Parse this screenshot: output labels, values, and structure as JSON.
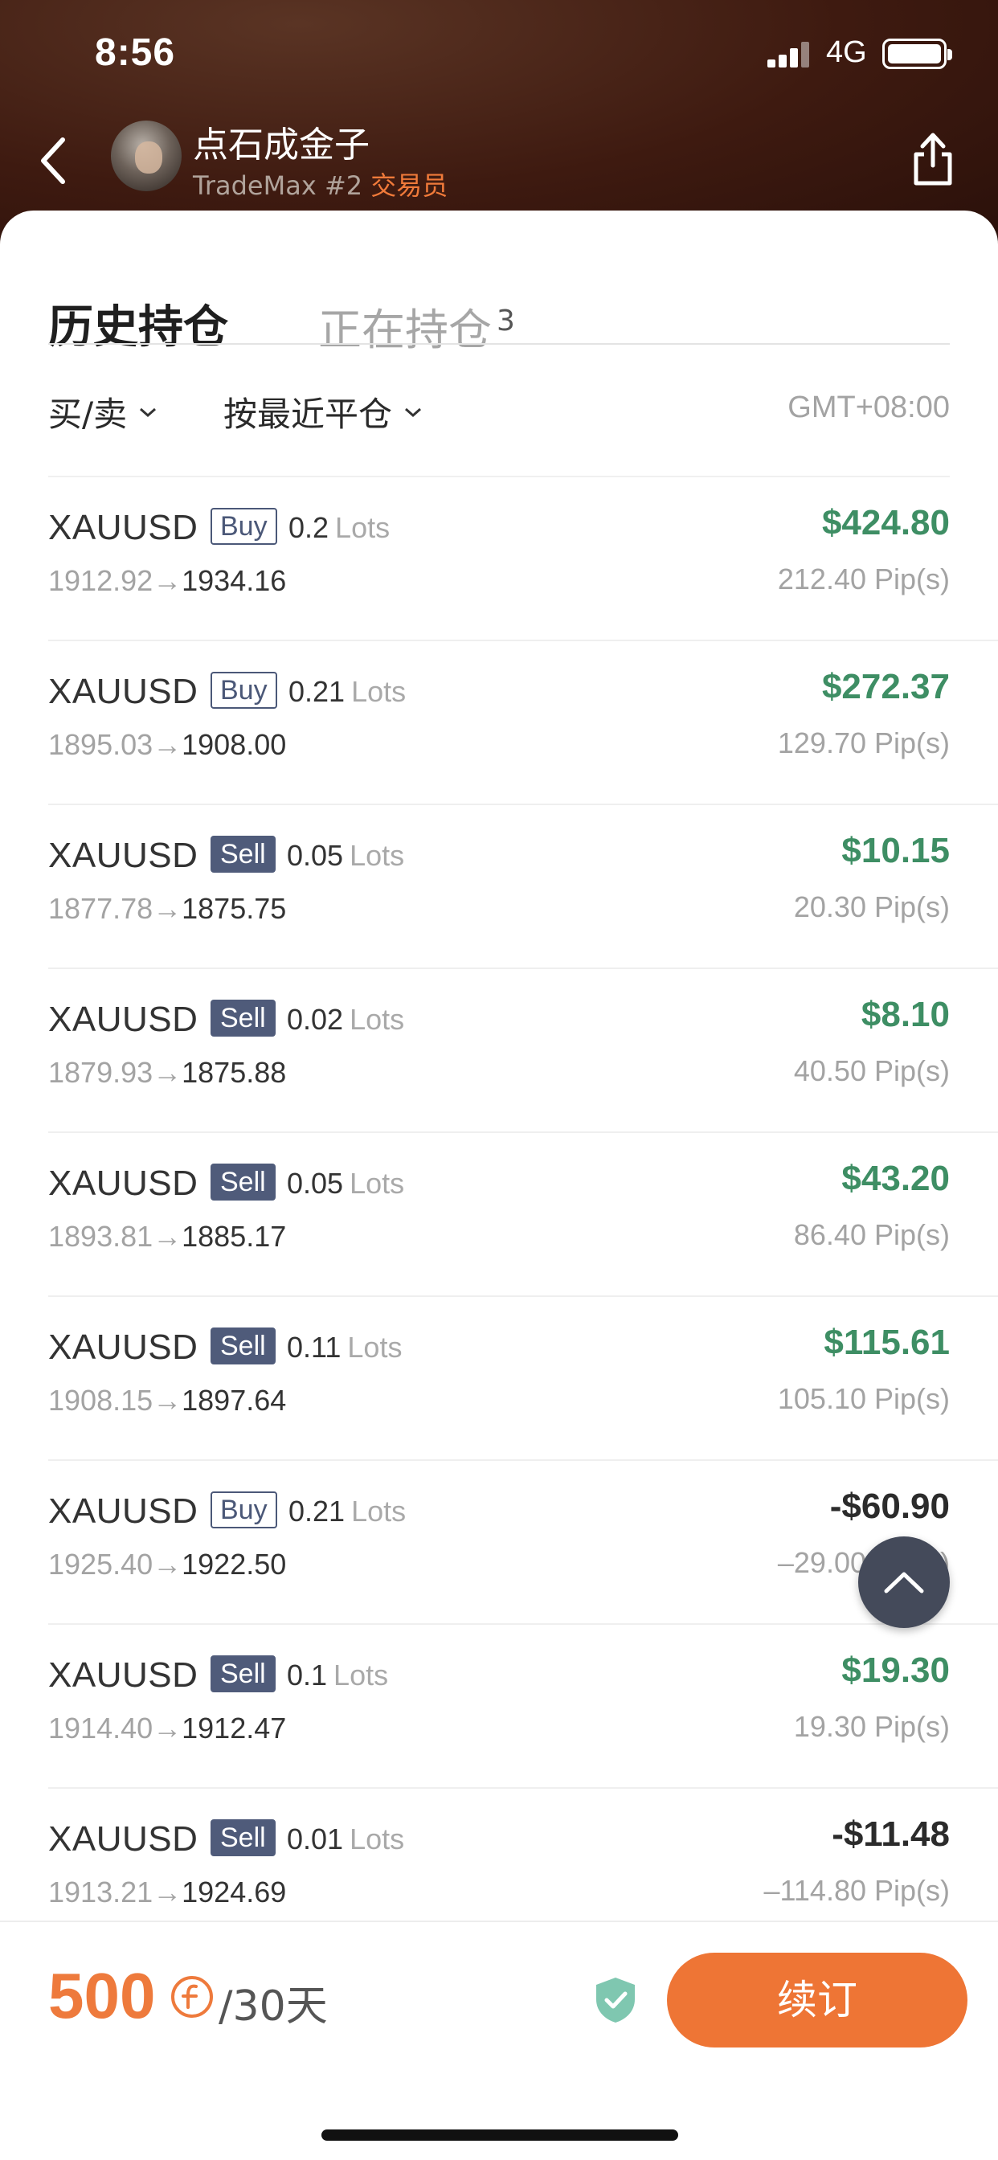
{
  "status_bar": {
    "time": "8:56",
    "network": "4G"
  },
  "header": {
    "trader_name": "点石成金子",
    "trader_rank": "TradeMax #2",
    "trader_role": "交易员"
  },
  "tabs": {
    "history": "历史持仓",
    "open": "正在持仓",
    "open_count": "3"
  },
  "filters": {
    "side": "买/卖",
    "sort": "按最近平仓",
    "timezone": "GMT+08:00"
  },
  "trades": [
    {
      "symbol": "XAUUSD",
      "side": "Buy",
      "lots": "0.2",
      "lots_unit": "Lots",
      "open": "1912.92",
      "close": "1934.16",
      "pnl": "$424.80",
      "pips": "212.40 Pip(s)",
      "positive": true
    },
    {
      "symbol": "XAUUSD",
      "side": "Buy",
      "lots": "0.21",
      "lots_unit": "Lots",
      "open": "1895.03",
      "close": "1908.00",
      "pnl": "$272.37",
      "pips": "129.70 Pip(s)",
      "positive": true
    },
    {
      "symbol": "XAUUSD",
      "side": "Sell",
      "lots": "0.05",
      "lots_unit": "Lots",
      "open": "1877.78",
      "close": "1875.75",
      "pnl": "$10.15",
      "pips": "20.30 Pip(s)",
      "positive": true
    },
    {
      "symbol": "XAUUSD",
      "side": "Sell",
      "lots": "0.02",
      "lots_unit": "Lots",
      "open": "1879.93",
      "close": "1875.88",
      "pnl": "$8.10",
      "pips": "40.50 Pip(s)",
      "positive": true
    },
    {
      "symbol": "XAUUSD",
      "side": "Sell",
      "lots": "0.05",
      "lots_unit": "Lots",
      "open": "1893.81",
      "close": "1885.17",
      "pnl": "$43.20",
      "pips": "86.40 Pip(s)",
      "positive": true
    },
    {
      "symbol": "XAUUSD",
      "side": "Sell",
      "lots": "0.11",
      "lots_unit": "Lots",
      "open": "1908.15",
      "close": "1897.64",
      "pnl": "$115.61",
      "pips": "105.10 Pip(s)",
      "positive": true
    },
    {
      "symbol": "XAUUSD",
      "side": "Buy",
      "lots": "0.21",
      "lots_unit": "Lots",
      "open": "1925.40",
      "close": "1922.50",
      "pnl": "-$60.90",
      "pips": "–29.00 Pip(s)",
      "positive": false
    },
    {
      "symbol": "XAUUSD",
      "side": "Sell",
      "lots": "0.1",
      "lots_unit": "Lots",
      "open": "1914.40",
      "close": "1912.47",
      "pnl": "$19.30",
      "pips": "19.30 Pip(s)",
      "positive": true
    },
    {
      "symbol": "XAUUSD",
      "side": "Sell",
      "lots": "0.01",
      "lots_unit": "Lots",
      "open": "1913.21",
      "close": "1924.69",
      "pnl": "-$11.48",
      "pips": "–114.80 Pip(s)",
      "positive": false
    }
  ],
  "footer": {
    "price": "500",
    "period": "/30天",
    "renew_label": "续订"
  },
  "colors": {
    "positive": "#3e8e64",
    "accent": "#ee7535",
    "badge": "#4f5b7a"
  },
  "icons": [
    "back-arrow-icon",
    "share-icon",
    "chevron-down-icon",
    "arrow-up-icon",
    "coin-icon",
    "shield-check-icon"
  ]
}
